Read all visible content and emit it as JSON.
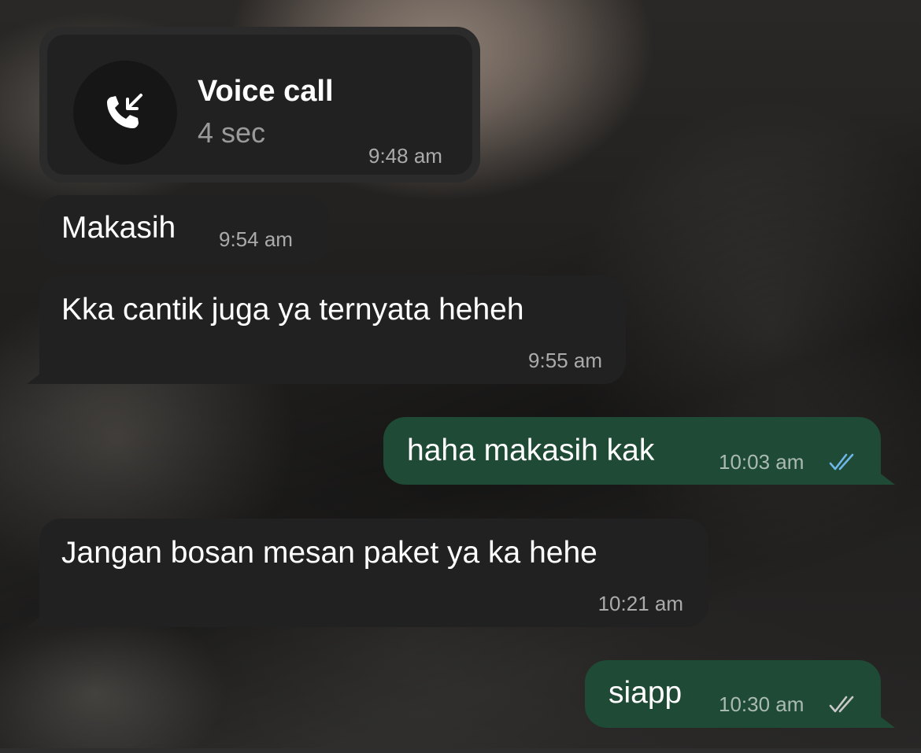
{
  "call": {
    "title": "Voice call",
    "duration": "4 sec",
    "time": "9:48 am",
    "icon": "incoming-call-icon"
  },
  "messages": [
    {
      "direction": "incoming",
      "text": "Makasih",
      "time": "9:54 am"
    },
    {
      "direction": "incoming",
      "text": "Kka cantik juga ya ternyata heheh",
      "time": "9:55 am"
    },
    {
      "direction": "outgoing",
      "text": "haha makasih kak",
      "time": "10:03 am",
      "status": "read",
      "tick_color": "#6fb6e8"
    },
    {
      "direction": "incoming",
      "text": "Jangan bosan mesan paket ya ka hehe",
      "time": "10:21 am"
    },
    {
      "direction": "outgoing",
      "text": "siapp",
      "time": "10:30 am",
      "status": "delivered",
      "tick_color": "#c8c8c8"
    }
  ],
  "colors": {
    "incoming_bubble": "#212121",
    "outgoing_bubble": "#1f4a35"
  }
}
